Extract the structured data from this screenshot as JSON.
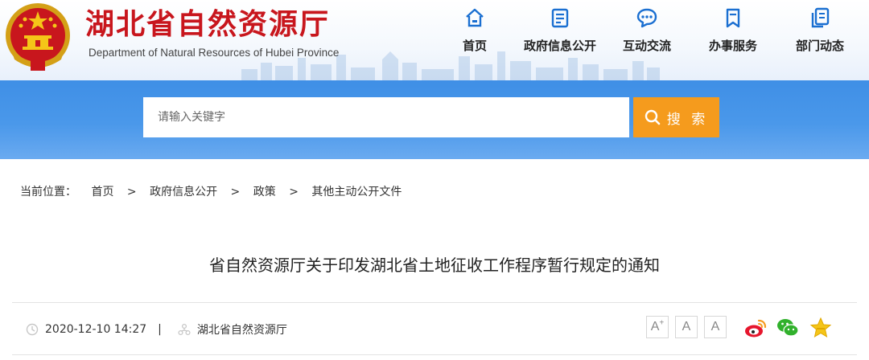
{
  "header": {
    "title": "湖北省自然资源厅",
    "subtitle": "Department of Natural Resources of Hubei Province"
  },
  "nav": [
    {
      "label": "首页",
      "icon": "home-icon"
    },
    {
      "label": "政府信息公开",
      "icon": "document-icon"
    },
    {
      "label": "互动交流",
      "icon": "chat-bubble-icon"
    },
    {
      "label": "办事服务",
      "icon": "bookmark-icon"
    },
    {
      "label": "部门动态",
      "icon": "copy-document-icon"
    }
  ],
  "search": {
    "placeholder": "请输入关键字",
    "button_label": "搜 索"
  },
  "breadcrumb": {
    "prefix": "当前位置：",
    "items": [
      "首页",
      "政府信息公开",
      "政策",
      "其他主动公开文件"
    ],
    "separator": ">"
  },
  "article": {
    "title": "省自然资源厅关于印发湖北省土地征收工作程序暂行规定的通知",
    "date": "2020-12-10 14:27",
    "divider": "|",
    "source": "湖北省自然资源厅"
  },
  "font_controls": {
    "increase": "A",
    "increase_mark": "+",
    "reset": "A",
    "decrease": "A"
  },
  "share": [
    "weibo-icon",
    "wechat-icon",
    "favorite-star-icon"
  ],
  "colors": {
    "title_red": "#c8161d",
    "nav_blue": "#1a6fd1",
    "band_blue": "#4a98ea",
    "search_orange": "#f59b1d"
  }
}
